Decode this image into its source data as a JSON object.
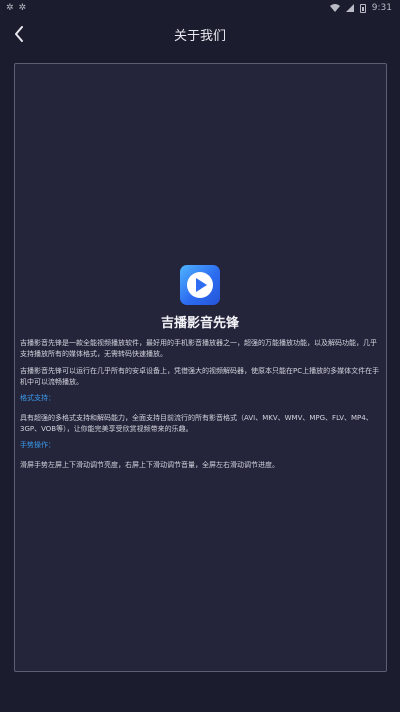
{
  "status_bar": {
    "left_icons": [
      "notification-icon",
      "notification-icon"
    ],
    "time": "9:31"
  },
  "nav": {
    "title": "关于我们"
  },
  "app": {
    "name": "吉播影音先锋",
    "logo_colors": [
      "#4fb4ff",
      "#2c6cf0"
    ]
  },
  "content": {
    "p1": "吉播影音先锋是一款全能视频播放软件，最好用的手机影音播放器之一，超强的万能播放功能，以及解码功能，几乎支持播放所有的媒体格式，无需转码快速播放。",
    "p2": "吉播影音先锋可以运行在几乎所有的安卓设备上，凭借强大的视频解码器，使原本只能在PC上播放的多媒体文件在手机中可以流畅播放。",
    "heading_formats": "格式支持：",
    "p3": "具有超强的多格式支持和解码能力，全面支持目前流行的所有影音格式（AVI、MKV、WMV、MPG、FLV、MP4、3GP、VOB等），让你能完美享受欣赏视频带来的乐趣。",
    "heading_gestures": "手势操作：",
    "p4": "滑屏手势左屏上下滑动调节亮度，右屏上下滑动调节音量，全屏左右滑动调节进度。"
  },
  "colors": {
    "background": "#1b1c2d",
    "card": "#24253a",
    "accent": "#3a9cf0"
  }
}
